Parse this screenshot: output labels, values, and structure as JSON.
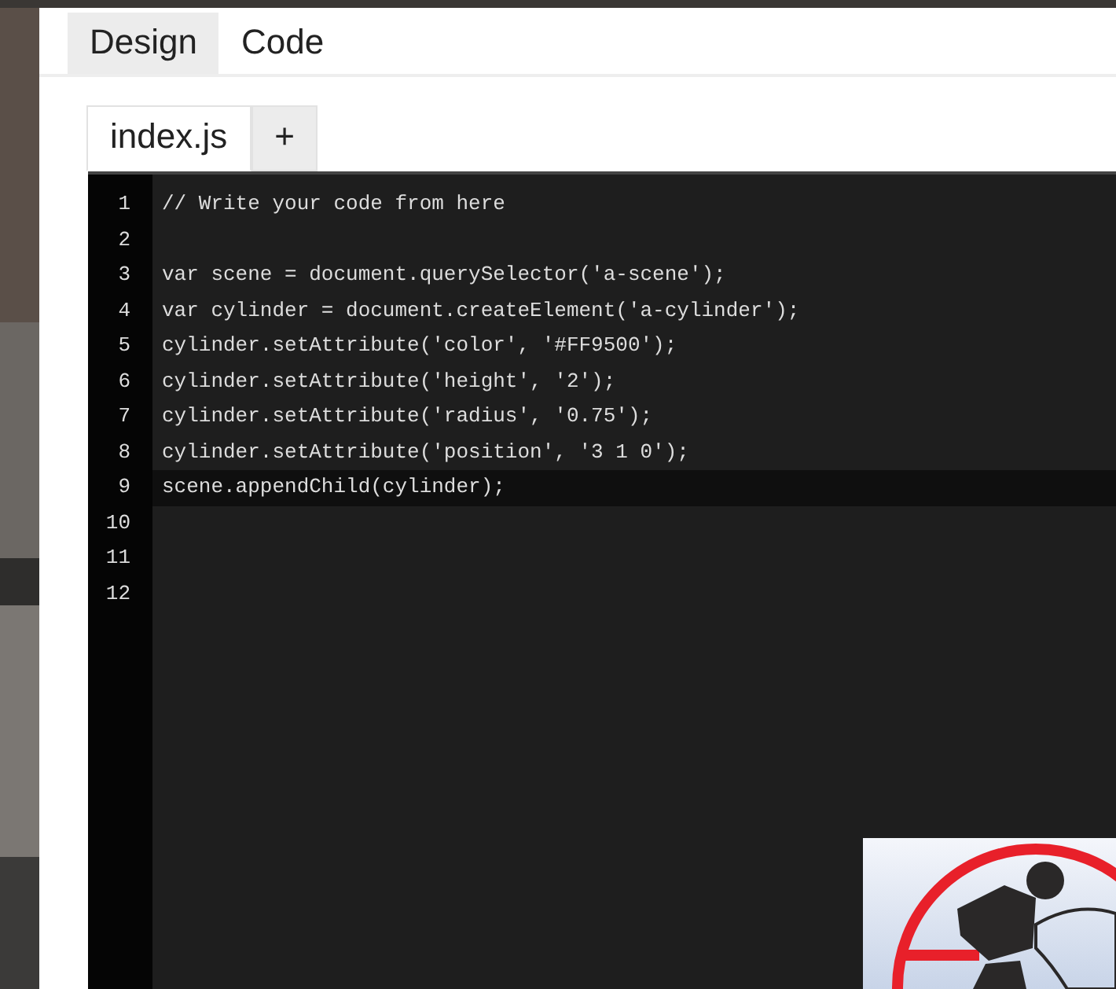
{
  "tabs": [
    {
      "label": "Design",
      "selected": false
    },
    {
      "label": "Code",
      "selected": true
    }
  ],
  "file_tabs": [
    {
      "label": "index.js",
      "selected": true
    },
    {
      "label": "+",
      "selected": false
    }
  ],
  "editor": {
    "lines": [
      {
        "number": "1",
        "code": "// Write your code from here",
        "active": false
      },
      {
        "number": "2",
        "active": false
      },
      {
        "number": "3",
        "code": "var scene = document.querySelector('a-scene');",
        "active": false
      },
      {
        "number": "4",
        "code": "var cylinder = document.createElement('a-cylinder');",
        "active": false
      },
      {
        "number": "5",
        "code": "cylinder.setAttribute('color', '#FF9500');",
        "active": false
      },
      {
        "number": "6",
        "code": "cylinder.setAttribute('height', '2');",
        "active": false
      },
      {
        "number": "7",
        "code": "cylinder.setAttribute('radius', '0.75');",
        "active": false
      },
      {
        "number": "8",
        "code": "cylinder.setAttribute('position', '3 1 0');",
        "active": false
      },
      {
        "number": "9",
        "code": "scene.appendChild(cylinder);",
        "active": true
      },
      {
        "number": "10",
        "active": false
      },
      {
        "number": "11",
        "active": false
      },
      {
        "number": "12",
        "active": false
      }
    ]
  }
}
